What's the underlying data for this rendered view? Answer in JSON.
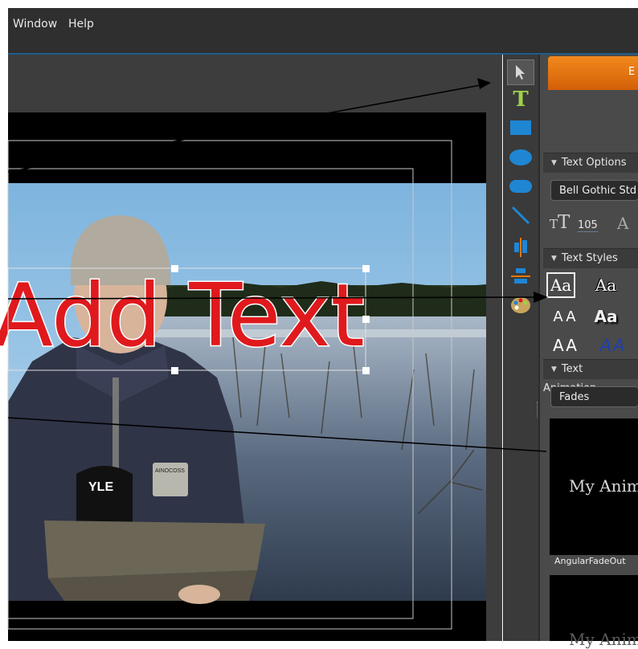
{
  "menu": {
    "window": "Window",
    "help": "Help"
  },
  "edit_tab": {
    "label": "E"
  },
  "video": {
    "overlay_text": "Add Text",
    "mic_logo": "YLE",
    "badge": "AINOCOSS"
  },
  "text_options": {
    "header": "Text Options",
    "font": "Bell Gothic Std",
    "font_size": "105"
  },
  "text_styles": {
    "header": "Text Styles",
    "samples": [
      "Aa",
      "Aa",
      "AA",
      "Aa",
      "AA",
      "AA"
    ]
  },
  "text_animation": {
    "header": "Text Animation",
    "category": "Fades",
    "preview_text": "My Anim",
    "preview_text_2": "My Anim",
    "item_label": "AngularFadeOut"
  },
  "colors": {
    "accent": "#e8780e",
    "title_red": "#e0191d",
    "panel_bg": "#4a4a4a"
  }
}
